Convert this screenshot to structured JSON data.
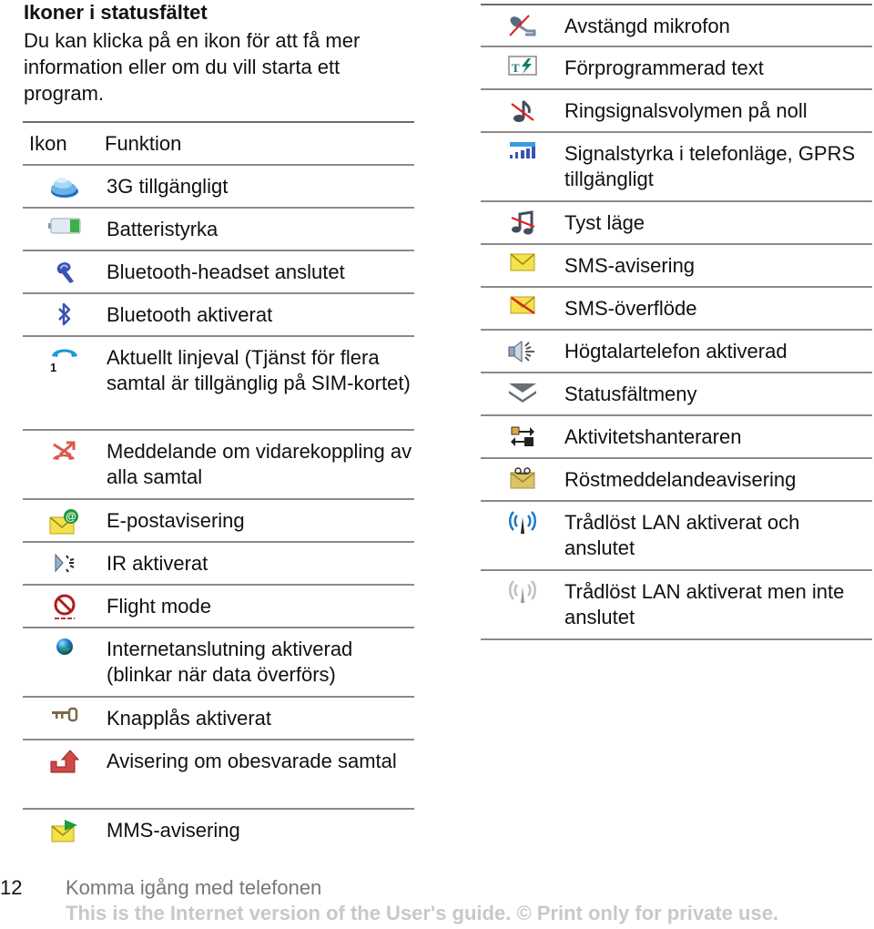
{
  "section": {
    "title": "Ikoner i statusfältet",
    "intro": "Du kan klicka på en ikon för att få mer information eller om du vill starta ett program."
  },
  "table_headers": {
    "icon": "Ikon",
    "function": "Funktion"
  },
  "left_rows": [
    {
      "icon": "3g-icon",
      "text": "3G tillgängligt"
    },
    {
      "icon": "battery-icon",
      "text": "Batteristyrka"
    },
    {
      "icon": "bluetooth-headset-icon",
      "text": "Bluetooth-headset anslutet"
    },
    {
      "icon": "bluetooth-icon",
      "text": "Bluetooth aktiverat"
    },
    {
      "icon": "line-1-phone-icon",
      "text": "Aktuellt linjeval (Tjänst för flera samtal är tillgänglig på SIM-kortet)"
    },
    {
      "icon": "call-divert-icon",
      "text": "Meddelande om vidarekoppling av alla samtal"
    },
    {
      "icon": "email-notification-icon",
      "text": "E-postavisering"
    },
    {
      "icon": "infrared-icon",
      "text": "IR aktiverat"
    },
    {
      "icon": "flight-mode-icon",
      "text": "Flight mode"
    },
    {
      "icon": "internet-globe-icon",
      "text": "Internetanslutning aktiverad (blinkar när data överförs)"
    },
    {
      "icon": "keylock-icon",
      "text": "Knapplås aktiverat"
    },
    {
      "icon": "missed-call-icon",
      "text": "Avisering om obesvarade samtal"
    },
    {
      "icon": "mms-notification-icon",
      "text": "MMS-avisering"
    }
  ],
  "right_rows": [
    {
      "icon": "microphone-muted-icon",
      "text": "Avstängd mikrofon"
    },
    {
      "icon": "predictive-text-icon",
      "text": "Förprogrammerad text"
    },
    {
      "icon": "ringtone-muted-icon",
      "text": "Ringsignalsvolymen på noll"
    },
    {
      "icon": "signal-strength-gprs-icon",
      "text": "Signalstyrka i telefonläge, GPRS tillgängligt"
    },
    {
      "icon": "silent-mode-icon",
      "text": "Tyst läge"
    },
    {
      "icon": "sms-notification-icon",
      "text": "SMS-avisering"
    },
    {
      "icon": "sms-overflow-icon",
      "text": "SMS-överflöde"
    },
    {
      "icon": "speakerphone-icon",
      "text": "Högtalartelefon aktiverad"
    },
    {
      "icon": "status-menu-icon",
      "text": "Statusfältmeny"
    },
    {
      "icon": "activity-manager-icon",
      "text": "Aktivitetshanteraren"
    },
    {
      "icon": "voicemail-icon",
      "text": "Röstmeddelandeavisering"
    },
    {
      "icon": "wlan-connected-icon",
      "text": "Trådlöst LAN aktiverat och anslutet"
    },
    {
      "icon": "wlan-not-connected-icon",
      "text": "Trådlöst LAN aktiverat men inte anslutet"
    }
  ],
  "footer": {
    "page_number": "12",
    "chapter": "Komma igång med telefonen",
    "notice": "This is the Internet version of the User's guide. © Print only for private use."
  }
}
